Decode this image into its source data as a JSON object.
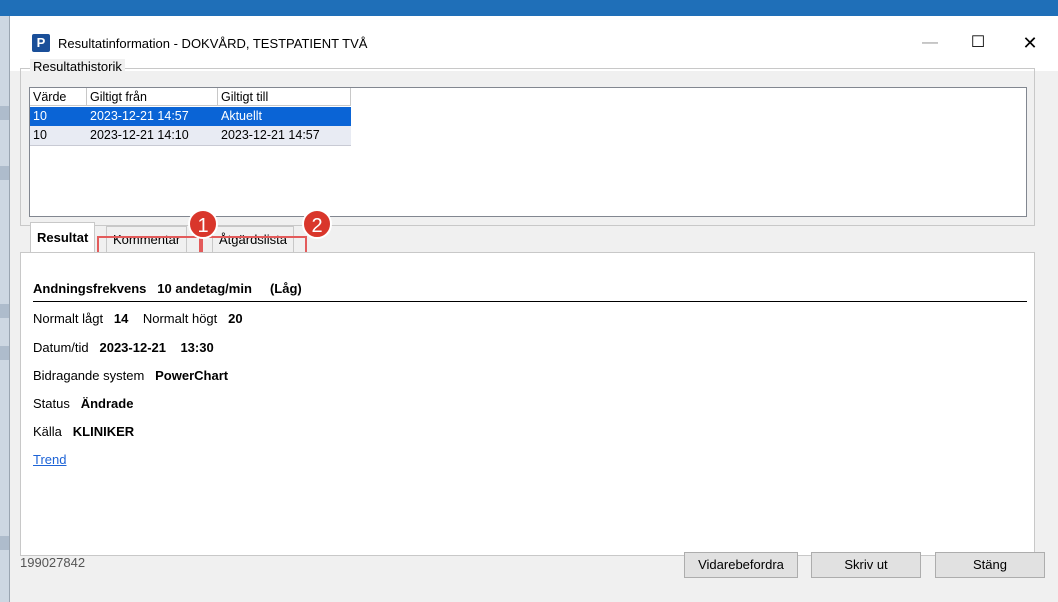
{
  "window": {
    "app_icon": "P",
    "title": "Resultatinformation - DOKVÅRD, TESTPATIENT TVÅ",
    "min_glyph": "—",
    "max_glyph": "☐",
    "close_glyph": "✕"
  },
  "history": {
    "label": "Resultathistorik",
    "columns": [
      "Värde",
      "Giltigt från",
      "Giltigt till"
    ],
    "rows": [
      [
        "10",
        "2023-12-21 14:57",
        "Aktuellt"
      ],
      [
        "10",
        "2023-12-21 14:10",
        "2023-12-21 14:57"
      ]
    ]
  },
  "tabs": {
    "items": [
      "Resultat",
      "Kommentar",
      "Åtgärdslista"
    ],
    "badges": [
      "1",
      "2"
    ]
  },
  "result": {
    "name": "Andningsfrekvens",
    "value": "10 andetag/min",
    "flag": "(Låg)",
    "normal_low_label": "Normalt lågt",
    "normal_low": "14",
    "normal_high_label": "Normalt högt",
    "normal_high": "20",
    "datetime_label": "Datum/tid",
    "date": "2023-12-21",
    "time": "13:30",
    "system_label": "Bidragande system",
    "system": "PowerChart",
    "status_label": "Status",
    "status": "Ändrade",
    "source_label": "Källa",
    "source": "KLINIKER",
    "trend_link": "Trend"
  },
  "footer": {
    "id": "199027842",
    "forward": "Vidarebefordra",
    "print": "Skriv ut",
    "close": "Stäng"
  },
  "colors": {
    "selection": "#0a64d6",
    "highlight": "#e35b5b",
    "badge": "#d9362b",
    "link": "#1d63d6"
  }
}
